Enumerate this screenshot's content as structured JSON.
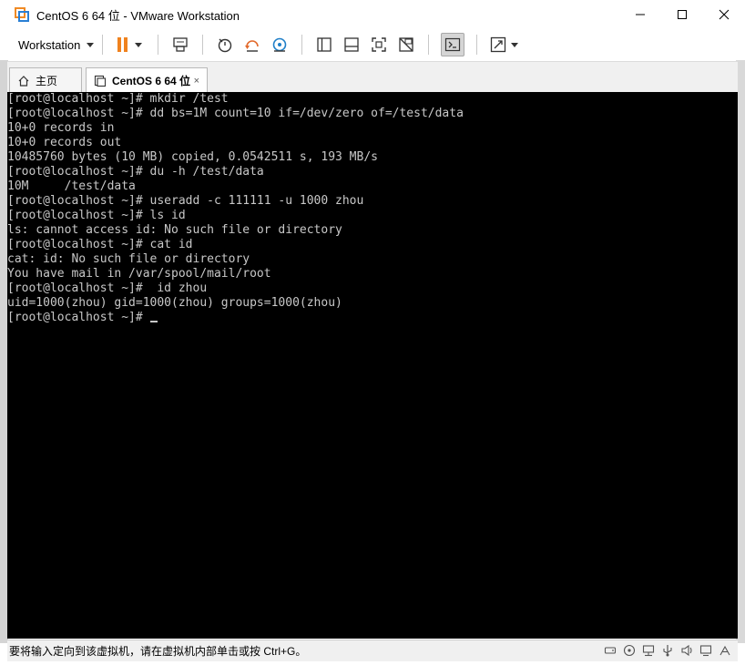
{
  "window": {
    "title": "CentOS 6 64 位 - VMware Workstation",
    "controls": [
      "minimize",
      "maximize",
      "close"
    ]
  },
  "toolbar": {
    "menu_label": "Workstation",
    "icons": [
      "pause-icon",
      "send-ctrl-alt-del-icon",
      "snapshot-take-icon",
      "snapshot-revert-icon",
      "snapshot-manager-icon",
      "library-view-icon",
      "thumbnail-view-icon",
      "fullscreen-icon",
      "unity-icon",
      "console-view-icon",
      "stretch-icon"
    ]
  },
  "tabs": [
    {
      "label": "主页",
      "icon": "home-icon"
    },
    {
      "label": "CentOS 6 64 位",
      "icon": "vm-icon",
      "close": "×"
    }
  ],
  "console": {
    "lines": [
      "[root@localhost ~]# mkdir /test",
      "[root@localhost ~]# dd bs=1M count=10 if=/dev/zero of=/test/data",
      "10+0 records in",
      "10+0 records out",
      "10485760 bytes (10 MB) copied, 0.0542511 s, 193 MB/s",
      "[root@localhost ~]# du -h /test/data",
      "10M     /test/data",
      "[root@localhost ~]# useradd -c 111111 -u 1000 zhou",
      "[root@localhost ~]# ls id",
      "ls: cannot access id: No such file or directory",
      "[root@localhost ~]# cat id",
      "cat: id: No such file or directory",
      "You have mail in /var/spool/mail/root",
      "[root@localhost ~]#  id zhou",
      "uid=1000(zhou) gid=1000(zhou) groups=1000(zhou)"
    ],
    "prompt": "[root@localhost ~]# "
  },
  "statusbar": {
    "text": "要将输入定向到该虚拟机，请在虚拟机内部单击或按 Ctrl+G。",
    "icons": [
      "hdd-icon",
      "cdrom-icon",
      "network-icon",
      "usb-icon",
      "sound-icon",
      "display-icon",
      "messages-icon"
    ]
  },
  "colors": {
    "console_bg": "#000000",
    "console_fg": "#c8c8c8",
    "pause_orange": "#f0821e"
  }
}
